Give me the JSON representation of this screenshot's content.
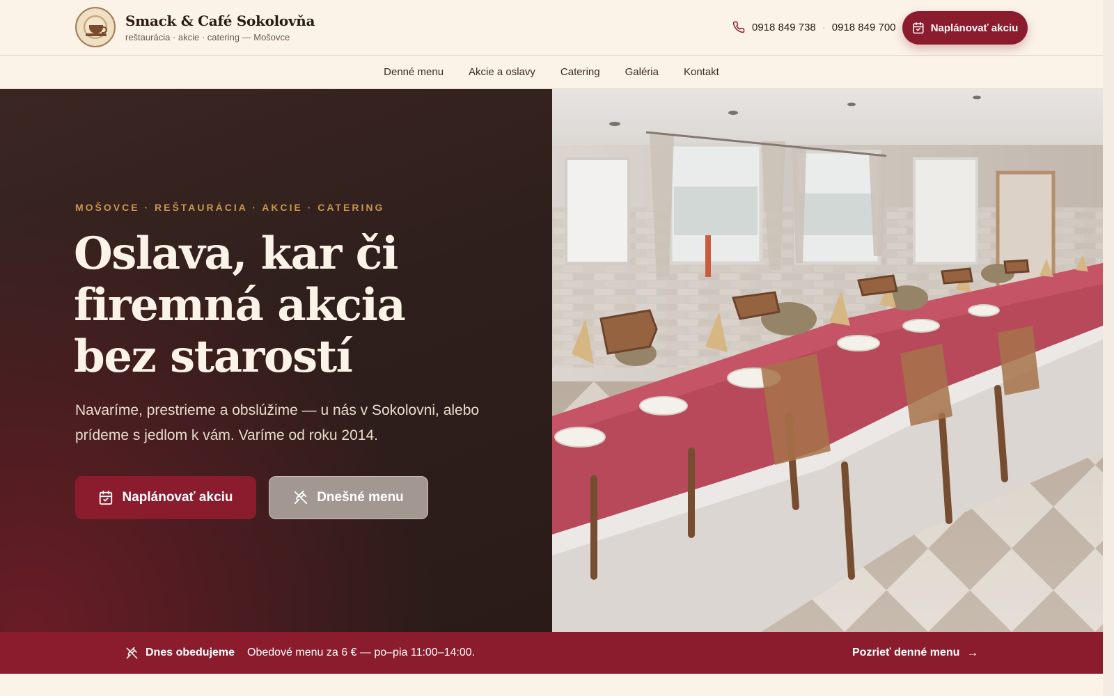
{
  "brand": {
    "name": "Smack & Café Sokolovňa",
    "tagline": "reštaurácia · akcie · catering — Mošovce"
  },
  "header": {
    "phone_1": "0918 849 738",
    "separator": "·",
    "phone_2": "0918 849 700",
    "cta_label": "Naplánovať akciu"
  },
  "nav": {
    "items": [
      {
        "label": "Denné menu"
      },
      {
        "label": "Akcie a oslavy"
      },
      {
        "label": "Catering"
      },
      {
        "label": "Galéria"
      },
      {
        "label": "Kontakt"
      }
    ]
  },
  "hero": {
    "eyebrow": "MOŠOVCE · REŠTAURÁCIA · AKCIE · CATERING",
    "title_line_1": "Oslava, kar či",
    "title_line_2": "firemná akcia",
    "title_line_3": "bez starostí",
    "text": "Navaríme, prestrieme a obslúžime — u nás v Sokolovni, alebo prídeme s jedlom k vám. Varíme od roku 2014.",
    "primary_label": "Naplánovať akciu",
    "secondary_label": "Dnešné menu"
  },
  "banner": {
    "title": "Dnes obedujeme",
    "text": "Obedové menu za 6 € — po–pia 11:00–14:00.",
    "link_label": "Pozrieť denné menu",
    "link_arrow": "→"
  },
  "colors": {
    "accent": "#8a1c2e",
    "background": "#fbf3e8",
    "hero_dark": "#2f1f1c",
    "eyebrow": "#c9954e"
  },
  "icons": {
    "phone": "phone-icon",
    "calendar": "calendar-icon",
    "cutlery": "cutlery-icon",
    "arrow": "arrow-right-icon"
  }
}
